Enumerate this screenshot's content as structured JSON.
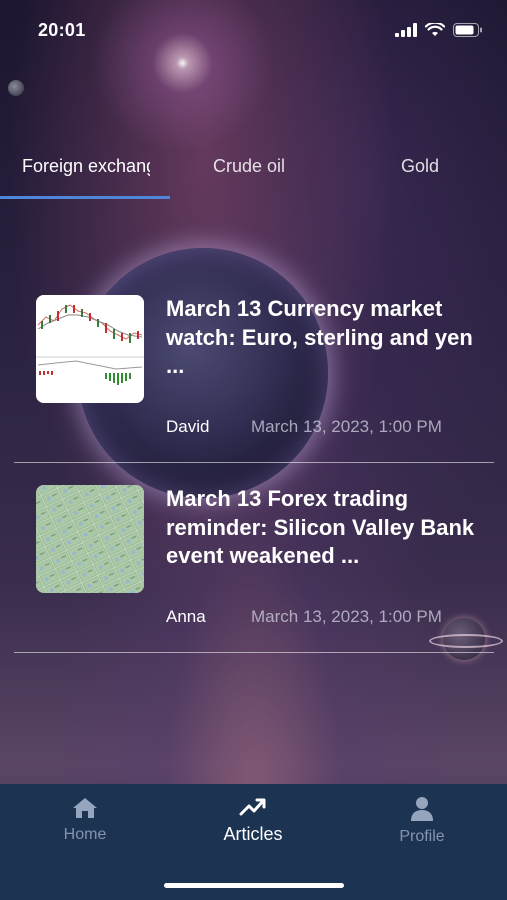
{
  "status_bar": {
    "time": "20:01"
  },
  "tabs": [
    {
      "label": "Foreign exchange",
      "active": true
    },
    {
      "label": "Crude oil",
      "active": false
    },
    {
      "label": "Gold",
      "active": false
    }
  ],
  "articles": [
    {
      "title": "March 13 Currency market watch: Euro, sterling and yen ...",
      "author": "David",
      "date": "March 13, 2023, 1:00 PM",
      "thumbnail": "forex-chart-thumbnail"
    },
    {
      "title": "March 13 Forex trading reminder: Silicon Valley Bank event weakened ...",
      "author": "Anna",
      "date": "March 13, 2023, 1:00 PM",
      "thumbnail": "banknotes-thumbnail"
    }
  ],
  "bottom_nav": [
    {
      "label": "Home",
      "icon": "home-icon",
      "active": false
    },
    {
      "label": "Articles",
      "icon": "trend-icon",
      "active": true
    },
    {
      "label": "Profile",
      "icon": "user-icon",
      "active": false
    }
  ],
  "colors": {
    "tab_indicator": "#4f86d9",
    "nav_background": "#1d3352",
    "nav_inactive": "#96a5be"
  }
}
